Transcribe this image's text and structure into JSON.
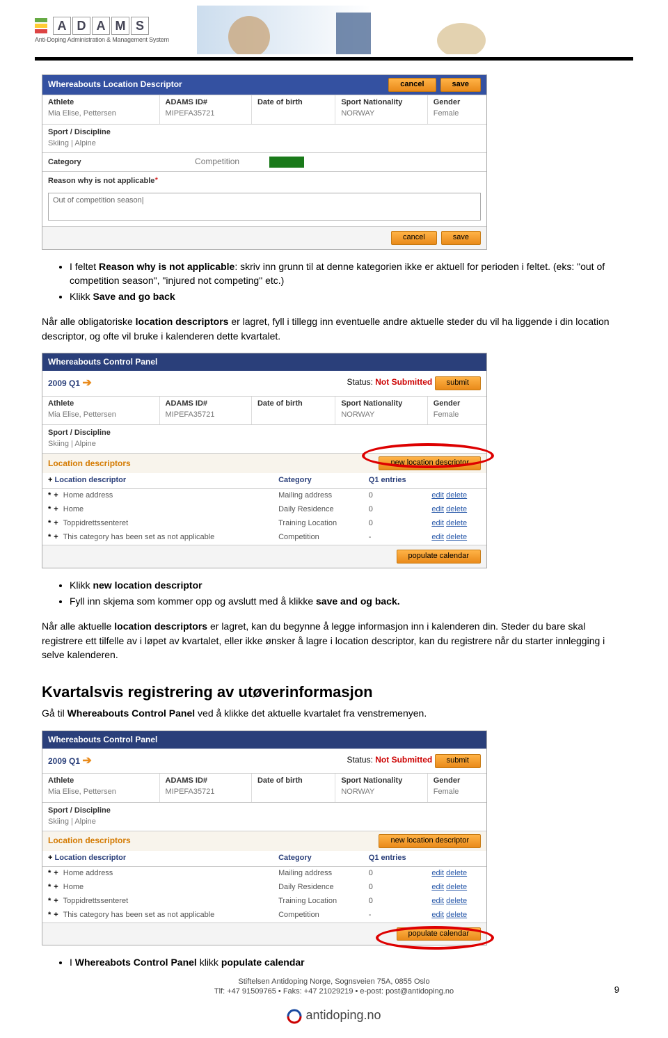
{
  "logo": {
    "letters": [
      "A",
      "D",
      "A",
      "M",
      "S"
    ],
    "subtitle": "Anti-Doping Administration & Management System"
  },
  "panel1": {
    "title": "Whereabouts Location Descriptor",
    "buttons": {
      "cancel": "cancel",
      "save": "save"
    },
    "athlete": {
      "label": "Athlete",
      "value": "Mia Elise, Pettersen"
    },
    "adamsid": {
      "label": "ADAMS ID#",
      "value": "MIPEFA35721"
    },
    "dob": {
      "label": "Date of birth",
      "value": ""
    },
    "nat": {
      "label": "Sport Nationality",
      "value": "NORWAY"
    },
    "gender": {
      "label": "Gender",
      "value": "Female"
    },
    "sport": {
      "label": "Sport / Discipline",
      "value": "Skiing | Alpine"
    },
    "category": {
      "label": "Category",
      "value": "Competition"
    },
    "reason": {
      "label": "Reason why is not applicable",
      "input": "Out of competition season|"
    }
  },
  "text": {
    "para1_a": "I feltet ",
    "para1_b": "Reason why is not applicable",
    "para1_c": ": skriv inn grunn til at denne kategorien ikke er aktuell for perioden i feltet. (eks: \"out of competition season\", \"injured not competing\" etc.)",
    "bullet2a": "Klikk ",
    "bullet2b": "Save and go back",
    "para2_a": "Når alle obligatoriske ",
    "para2_b": "location descriptors",
    "para2_c": " er lagret, fyll i tillegg inn eventuelle andre aktuelle steder du vil ha liggende i din location descriptor, og ofte vil bruke i kalenderen dette kvartalet.",
    "bullet3a": "Klikk ",
    "bullet3b": "new location descriptor",
    "bullet4a": "Fyll inn skjema som kommer opp og avslutt med å klikke ",
    "bullet4b": "save and og back.",
    "para3_a": "Når alle aktuelle ",
    "para3_b": "location descriptors",
    "para3_c": " er lagret, kan du begynne å legge informasjon inn i kalenderen din. Steder du bare skal registrere ett tilfelle av i løpet av kvartalet, eller ikke ønsker å lagre i location descriptor, kan du registrere når du starter innlegging i selve kalenderen.",
    "heading": "Kvartalsvis registrering av utøverinformasjon",
    "para4_a": "Gå til ",
    "para4_b": "Whereabouts Control Panel",
    "para4_c": " ved å klikke det aktuelle kvartalet fra venstremenyen.",
    "bullet5a": "I ",
    "bullet5b": "Whereabots Control Panel",
    "bullet5c": " klikk ",
    "bullet5d": "populate calendar"
  },
  "controlPanel": {
    "title": "Whereabouts Control Panel",
    "quarter": "2009 Q1",
    "status_label": "Status:",
    "status_value": "Not Submitted",
    "submit": "submit",
    "newLocBtn": "new location descriptor",
    "popCalBtn": "populate calendar",
    "locHeader": "Location descriptors",
    "cols": {
      "loc": "Location descriptor",
      "cat": "Category",
      "q1": "Q1 entries"
    },
    "rows": [
      {
        "mark": "*",
        "plus": "+",
        "name": "Home address",
        "cat": "Mailing address",
        "q1": "0"
      },
      {
        "mark": "*",
        "plus": "+",
        "name": "Home",
        "cat": "Daily Residence",
        "q1": "0"
      },
      {
        "mark": "*",
        "plus": "+",
        "name": "Toppidrettssenteret",
        "cat": "Training Location",
        "q1": "0"
      },
      {
        "mark": "*",
        "plus": "+",
        "name": "This category has been set as not applicable",
        "cat": "Competition",
        "q1": "-"
      }
    ],
    "edit": "edit",
    "delete": "delete"
  },
  "footer": {
    "line1": "Stiftelsen Antidoping Norge, Sognsveien 75A, 0855 Oslo",
    "line2": "Tlf: +47 91509765 • Faks: +47 21029219 • e-post: post@antidoping.no",
    "logo": "antidoping.no",
    "page": "9"
  }
}
